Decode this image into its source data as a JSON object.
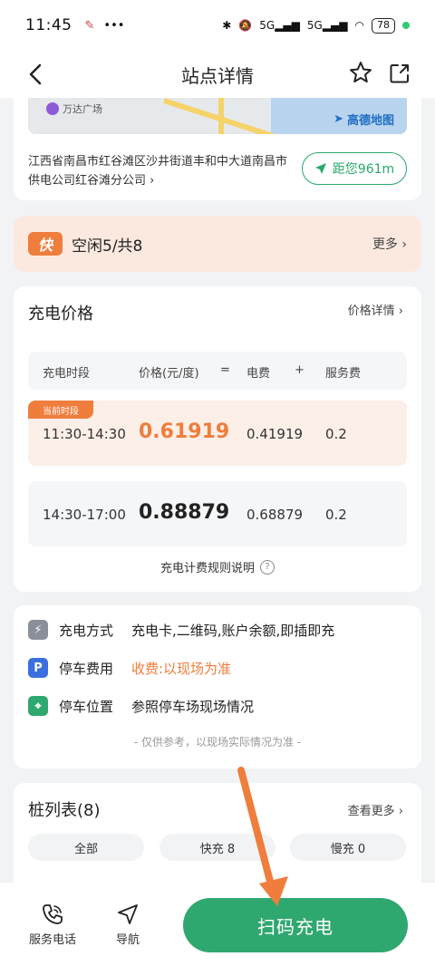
{
  "status_bar": {
    "time": "11:45",
    "battery": "78"
  },
  "header": {
    "title": "站点详情"
  },
  "map": {
    "poi_label": "万达广场",
    "brand": "高德地图"
  },
  "station": {
    "address": "江西省南昌市红谷滩区沙井街道丰和中大道南昌市供电公司红谷滩分公司 ›",
    "distance": "距您961m"
  },
  "availability": {
    "badge": "快",
    "text": "空闲5/共8",
    "more": "更多 ›"
  },
  "pricing": {
    "title": "充电价格",
    "detail_link": "价格详情 ›",
    "headers": [
      "充电时段",
      "价格(元/度)",
      "=",
      "电费",
      "+",
      "服务费"
    ],
    "current_tag": "当前时段",
    "rows": [
      {
        "period": "11:30-14:30",
        "price": "0.61919",
        "electricity": "0.41919",
        "service": "0.2"
      },
      {
        "period": "14:30-17:00",
        "price": "0.88879",
        "electricity": "0.68879",
        "service": "0.2"
      }
    ],
    "rule_link": "充电计费规则说明"
  },
  "info": {
    "charge_method_label": "充电方式",
    "charge_method_value": "充电卡,二维码,账户余额,即插即充",
    "parking_fee_label": "停车费用",
    "parking_fee_value": "收费:以现场为准",
    "parking_location_label": "停车位置",
    "parking_location_value": "参照停车场现场情况",
    "footnote": "- 仅供参考，以现场实际情况为准 -"
  },
  "piles": {
    "title": "桩列表(8)",
    "more": "查看更多 ›",
    "filters": [
      "全部",
      "快充 8",
      "慢充 0"
    ]
  },
  "bottom": {
    "service_phone": "服务电话",
    "navigate": "导航",
    "scan_charge": "扫码充电"
  },
  "colors": {
    "green": "#2fa86f",
    "orange": "#ef7d3c"
  }
}
